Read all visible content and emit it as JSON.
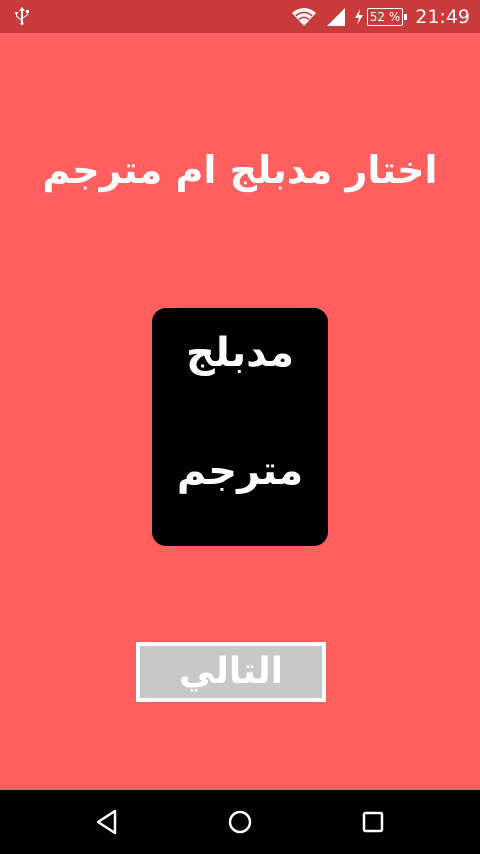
{
  "status_bar": {
    "time": "21:49",
    "battery_level": "52 %",
    "icons": [
      "usb-icon",
      "wifi-icon",
      "signal-icon",
      "charging-bolt-icon",
      "battery-icon"
    ]
  },
  "screen": {
    "title": "اختار مدبلج ام مترجم",
    "options": [
      {
        "label": "مدبلج"
      },
      {
        "label": "مترجم"
      }
    ],
    "next_label": "التالي"
  },
  "nav_bar": {
    "icons": [
      "back-icon",
      "home-icon",
      "recent-apps-icon"
    ]
  },
  "colors": {
    "background": "#ff5f5f",
    "status_bar": "#c93a3a",
    "card": "#000000",
    "button": "#c8c8c8",
    "text": "#ffffff"
  }
}
